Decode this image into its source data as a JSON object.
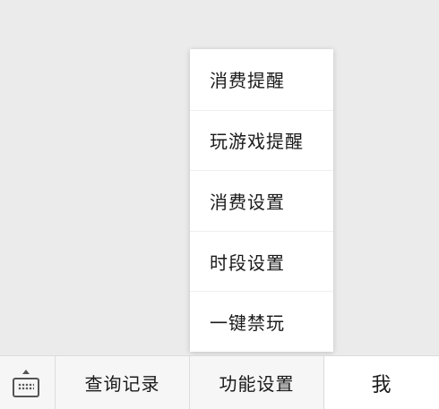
{
  "popup_menu": {
    "items": [
      {
        "label": "消费提醒"
      },
      {
        "label": "玩游戏提醒"
      },
      {
        "label": "消费设置"
      },
      {
        "label": "时段设置"
      },
      {
        "label": "一键禁玩"
      }
    ]
  },
  "bottom_bar": {
    "keyboard_toggle_icon": "keyboard-icon",
    "tabs": [
      {
        "label": "查询记录"
      },
      {
        "label": "功能设置"
      },
      {
        "label": "我"
      }
    ]
  }
}
